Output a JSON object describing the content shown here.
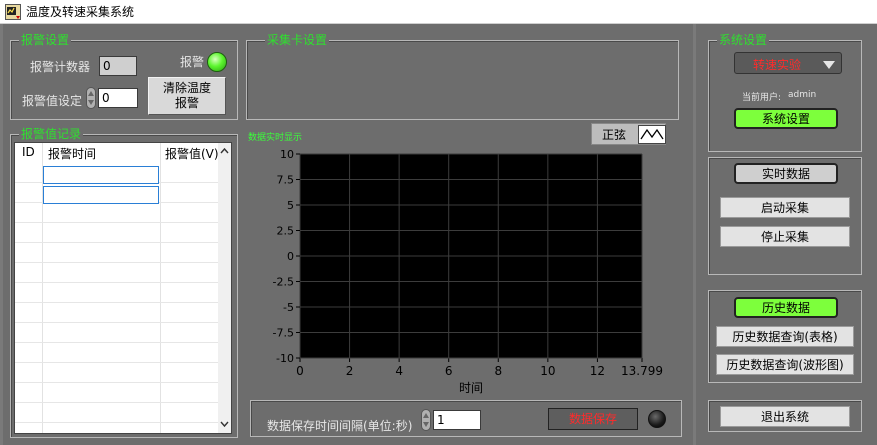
{
  "window": {
    "title": "温度及转速采集系统"
  },
  "alarm_settings": {
    "group_label": "报警设置",
    "counter_label": "报警计数器",
    "counter_value": "0",
    "alarm_label": "报警",
    "setpoint_label": "报警值设定",
    "setpoint_value": "0",
    "clear_button_line1": "清除温度",
    "clear_button_line2": "报警"
  },
  "daq_settings": {
    "group_label": "采集卡设置"
  },
  "alarm_records": {
    "group_label": "报警值记录",
    "columns": [
      "ID",
      "报警时间",
      "报警值(V)"
    ]
  },
  "chart_panel": {
    "label": "数据实时显示",
    "waveform_toggle_label": "正弦",
    "save_interval_label": "数据保存时间间隔(单位:秒)",
    "save_interval_value": "1",
    "save_button": "数据保存"
  },
  "chart_data": {
    "type": "line",
    "xlabel": "时间",
    "ylabel": "",
    "x_ticks": [
      "0",
      "2",
      "4",
      "6",
      "8",
      "10",
      "12",
      "13.799"
    ],
    "x_tick_values": [
      0,
      2,
      4,
      6,
      8,
      10,
      12,
      13.799
    ],
    "y_ticks": [
      "10",
      "7.5",
      "5",
      "2.5",
      "0",
      "-2.5",
      "-5",
      "-7.5",
      "-10"
    ],
    "y_tick_values": [
      10,
      7.5,
      5,
      2.5,
      0,
      -2.5,
      -5,
      -7.5,
      -10
    ],
    "xlim": [
      0,
      13.799
    ],
    "ylim": [
      -10,
      10
    ],
    "grid": true,
    "series": []
  },
  "system_settings": {
    "group_label": "系统设置",
    "mode_value": "转速实验",
    "user_label": "当前用户:",
    "user_value": "admin",
    "settings_button": "系统设置"
  },
  "realtime": {
    "indicator": "实时数据",
    "start_button": "启动采集",
    "stop_button": "停止采集"
  },
  "history": {
    "indicator": "历史数据",
    "table_query_button": "历史数据查询(表格)",
    "waveform_query_button": "历史数据查询(波形图)"
  },
  "exit": {
    "button": "退出系统"
  },
  "colors": {
    "panel_bg": "#6d6d6d",
    "group_label": "#2fe02f",
    "led_green": "#5cf52e",
    "indicator_green": "#7dff3c",
    "dropdown_text": "#ff2b2b",
    "save_text": "#ff2b2b",
    "plot_bg": "#000000"
  }
}
